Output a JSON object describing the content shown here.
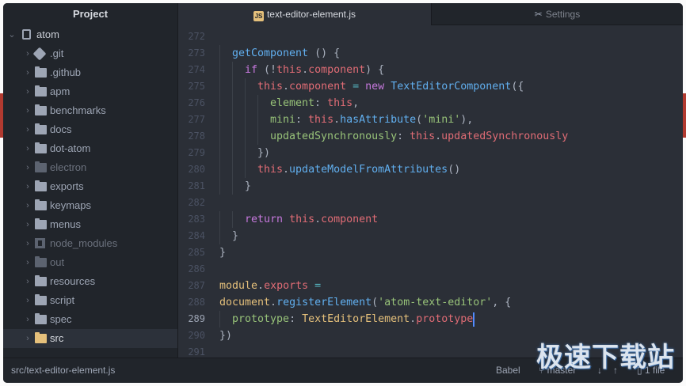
{
  "sidebar": {
    "title": "Project",
    "root": "atom",
    "items": [
      {
        "label": ".git",
        "icon": "git-icon"
      },
      {
        "label": ".github",
        "icon": "folder-icon"
      },
      {
        "label": "apm",
        "icon": "folder-icon"
      },
      {
        "label": "benchmarks",
        "icon": "folder-icon"
      },
      {
        "label": "docs",
        "icon": "folder-icon"
      },
      {
        "label": "dot-atom",
        "icon": "folder-icon"
      },
      {
        "label": "electron",
        "icon": "folder-icon",
        "dim": true
      },
      {
        "label": "exports",
        "icon": "folder-icon"
      },
      {
        "label": "keymaps",
        "icon": "folder-icon"
      },
      {
        "label": "menus",
        "icon": "folder-icon"
      },
      {
        "label": "node_modules",
        "icon": "module-icon",
        "dim": true
      },
      {
        "label": "out",
        "icon": "folder-icon",
        "dim": true
      },
      {
        "label": "resources",
        "icon": "folder-icon"
      },
      {
        "label": "script",
        "icon": "folder-icon"
      },
      {
        "label": "spec",
        "icon": "folder-icon"
      },
      {
        "label": "src",
        "icon": "folder-icon",
        "selected": true
      }
    ]
  },
  "tabs": {
    "active": {
      "label": "text-editor-element.js",
      "icon_text": "JS"
    },
    "inactive": {
      "label": "Settings"
    }
  },
  "editor": {
    "current_line": 289,
    "lines": [
      {
        "n": "272",
        "indent": 0,
        "tokens": []
      },
      {
        "n": "273",
        "indent": 1,
        "tokens": [
          [
            "fn",
            "getComponent"
          ],
          [
            "pl",
            " () {"
          ]
        ]
      },
      {
        "n": "274",
        "indent": 2,
        "tokens": [
          [
            "kw",
            "if"
          ],
          [
            "pl",
            " (!"
          ],
          [
            "this",
            "this"
          ],
          [
            "pl",
            "."
          ],
          [
            "prop",
            "component"
          ],
          [
            "pl",
            ") {"
          ]
        ]
      },
      {
        "n": "275",
        "indent": 3,
        "tokens": [
          [
            "this",
            "this"
          ],
          [
            "pl",
            "."
          ],
          [
            "prop",
            "component"
          ],
          [
            "pl",
            " "
          ],
          [
            "op",
            "="
          ],
          [
            "pl",
            " "
          ],
          [
            "kw",
            "new"
          ],
          [
            "pl",
            " "
          ],
          [
            "fn",
            "TextEditorComponent"
          ],
          [
            "pl",
            "({"
          ]
        ]
      },
      {
        "n": "276",
        "indent": 4,
        "tokens": [
          [
            "key",
            "element"
          ],
          [
            "pl",
            ": "
          ],
          [
            "this",
            "this"
          ],
          [
            "pl",
            ","
          ]
        ]
      },
      {
        "n": "277",
        "indent": 4,
        "tokens": [
          [
            "key",
            "mini"
          ],
          [
            "pl",
            ": "
          ],
          [
            "this",
            "this"
          ],
          [
            "pl",
            "."
          ],
          [
            "fn",
            "hasAttribute"
          ],
          [
            "pl",
            "("
          ],
          [
            "str",
            "'mini'"
          ],
          [
            "pl",
            "),"
          ]
        ]
      },
      {
        "n": "278",
        "indent": 4,
        "tokens": [
          [
            "key",
            "updatedSynchronously"
          ],
          [
            "pl",
            ": "
          ],
          [
            "this",
            "this"
          ],
          [
            "pl",
            "."
          ],
          [
            "prop",
            "updatedSynchronously"
          ]
        ]
      },
      {
        "n": "279",
        "indent": 3,
        "tokens": [
          [
            "pl",
            "})"
          ]
        ]
      },
      {
        "n": "280",
        "indent": 3,
        "tokens": [
          [
            "this",
            "this"
          ],
          [
            "pl",
            "."
          ],
          [
            "fn",
            "updateModelFromAttributes"
          ],
          [
            "pl",
            "()"
          ]
        ]
      },
      {
        "n": "281",
        "indent": 2,
        "tokens": [
          [
            "pl",
            "}"
          ]
        ]
      },
      {
        "n": "282",
        "indent": 0,
        "tokens": []
      },
      {
        "n": "283",
        "indent": 2,
        "tokens": [
          [
            "kw",
            "return"
          ],
          [
            "pl",
            " "
          ],
          [
            "this",
            "this"
          ],
          [
            "pl",
            "."
          ],
          [
            "prop",
            "component"
          ]
        ]
      },
      {
        "n": "284",
        "indent": 1,
        "tokens": [
          [
            "pl",
            "}"
          ]
        ]
      },
      {
        "n": "285",
        "indent": 0,
        "tokens": [
          [
            "pl",
            "}"
          ]
        ]
      },
      {
        "n": "286",
        "indent": 0,
        "tokens": []
      },
      {
        "n": "287",
        "indent": 0,
        "tokens": [
          [
            "cls",
            "module"
          ],
          [
            "pl",
            "."
          ],
          [
            "prop",
            "exports"
          ],
          [
            "pl",
            " "
          ],
          [
            "op",
            "="
          ]
        ]
      },
      {
        "n": "288",
        "indent": 0,
        "tokens": [
          [
            "cls",
            "document"
          ],
          [
            "pl",
            "."
          ],
          [
            "fn",
            "registerElement"
          ],
          [
            "pl",
            "("
          ],
          [
            "str",
            "'atom-text-editor'"
          ],
          [
            "pl",
            ", {"
          ]
        ]
      },
      {
        "n": "289",
        "indent": 1,
        "tokens": [
          [
            "key",
            "prototype"
          ],
          [
            "pl",
            ": "
          ],
          [
            "cls",
            "TextEditorElement"
          ],
          [
            "pl",
            "."
          ],
          [
            "prop",
            "prototype"
          ]
        ]
      },
      {
        "n": "290",
        "indent": 0,
        "tokens": [
          [
            "pl",
            "})"
          ]
        ]
      },
      {
        "n": "291",
        "indent": 0,
        "tokens": []
      }
    ]
  },
  "status": {
    "file_path": "src/text-editor-element.js",
    "grammar": "Babel",
    "branch": "master",
    "file_count": "1 file"
  },
  "watermark": "极速下载站",
  "colors": {
    "keyword": "#c678dd",
    "function": "#61afef",
    "this": "#e06c75",
    "class": "#e5c07b",
    "string": "#98c379",
    "accent_stripe": "#b23a30"
  }
}
